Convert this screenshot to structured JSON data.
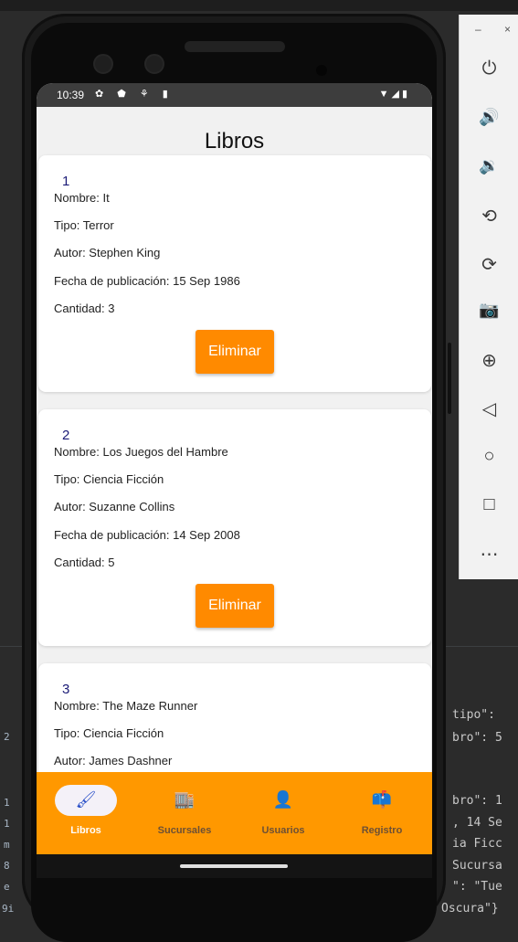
{
  "editor": {
    "gutter": [
      "2",
      "1",
      "1",
      "m",
      "8",
      "e",
      "9i"
    ],
    "lines": [
      "tipo\":",
      "bro\": 5",
      "bro\": 1",
      ", 14 Se",
      "ia Ficc",
      "Sucursa",
      "\": \"Tue",
      "Oscura\"}"
    ]
  },
  "statusbar": {
    "time": "10:39",
    "left_icons": "✿ ⬟ ⚘ ▮",
    "right_icons": "▼◢▮"
  },
  "app": {
    "title": "Libros",
    "books": [
      {
        "id": "1",
        "nombre": "Nombre: It",
        "tipo": "Tipo: Terror",
        "autor": "Autor: Stephen King",
        "fecha": "Fecha de publicación: 15 Sep 1986",
        "cantidad": "Cantidad: 3",
        "button": "Eliminar"
      },
      {
        "id": "2",
        "nombre": "Nombre: Los Juegos del Hambre",
        "tipo": "Tipo: Ciencia Ficción",
        "autor": "Autor: Suzanne Collins",
        "fecha": "Fecha de publicación: 14 Sep 2008",
        "cantidad": "Cantidad: 5",
        "button": "Eliminar"
      },
      {
        "id": "3",
        "nombre": "Nombre: The Maze Runner",
        "tipo": "Tipo: Ciencia Ficción",
        "autor": "Autor: James Dashner"
      }
    ],
    "nav": [
      {
        "label": "Libros",
        "icon": "brush-icon",
        "glyph": "🖌",
        "active": true
      },
      {
        "label": "Sucursales",
        "icon": "store-icon",
        "glyph": "🏬",
        "active": false
      },
      {
        "label": "Usuarios",
        "icon": "person-icon",
        "glyph": "👤",
        "active": false
      },
      {
        "label": "Registro",
        "icon": "mailbox-icon",
        "glyph": "📫",
        "active": false
      }
    ]
  },
  "emulator": {
    "minimize": "–",
    "close": "×",
    "buttons": [
      {
        "name": "power-icon",
        "glyph": "⏻"
      },
      {
        "name": "volume-up-icon",
        "glyph": "🔊"
      },
      {
        "name": "volume-down-icon",
        "glyph": "🔉"
      },
      {
        "name": "rotate-left-icon",
        "glyph": "⟲"
      },
      {
        "name": "rotate-right-icon",
        "glyph": "⟳"
      },
      {
        "name": "camera-icon",
        "glyph": "📷"
      },
      {
        "name": "zoom-icon",
        "glyph": "⊕"
      },
      {
        "name": "back-icon",
        "glyph": "◁"
      },
      {
        "name": "home-icon",
        "glyph": "○"
      },
      {
        "name": "overview-icon",
        "glyph": "□"
      },
      {
        "name": "more-icon",
        "glyph": "⋯"
      }
    ]
  },
  "colors": {
    "accent": "#ff9800",
    "button": "#ff8a00",
    "id_text": "#1b1b77"
  }
}
